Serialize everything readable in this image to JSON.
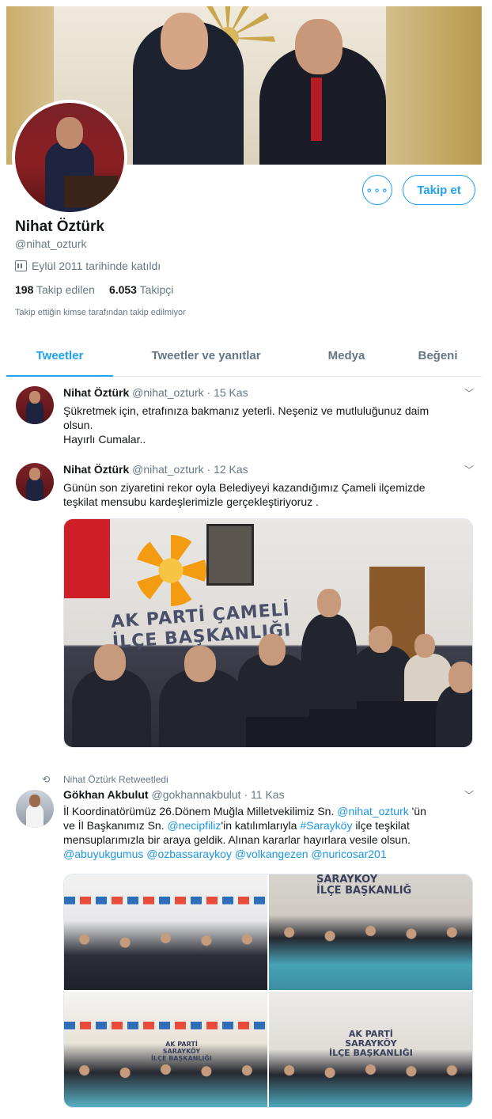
{
  "profile": {
    "name": "Nihat Öztürk",
    "handle": "@nihat_ozturk",
    "joined": "Eylül 2011 tarihinde katıldı",
    "following_count": "198",
    "following_label": "Takip edilen",
    "followers_count": "6.053",
    "followers_label": "Takipçi",
    "notice": "Takip ettiğin kimse tarafından takip edilmiyor",
    "more_label": "∘∘∘",
    "follow_label": "Takip et"
  },
  "tabs": [
    {
      "label": "Tweetler",
      "active": true
    },
    {
      "label": "Tweetler ve yanıtlar",
      "active": false
    },
    {
      "label": "Medya",
      "active": false
    },
    {
      "label": "Beğeni",
      "active": false
    }
  ],
  "tweets": [
    {
      "author": "Nihat Öztürk",
      "handle": "@nihat_ozturk",
      "date": "15 Kas",
      "text_lines": [
        "Şükretmek için, etrafınıza bakmanız yeterli. Neşeniz ve mutluluğunuz daim",
        "olsun.",
        "Hayırlı Cumalar.."
      ]
    },
    {
      "author": "Nihat Öztürk",
      "handle": "@nihat_ozturk",
      "date": "12 Kas",
      "text_lines": [
        "Günün son ziyaretini rekor oyla Belediyeyi kazandığımız Çameli ilçemizde",
        "teşkilat mensubu kardeşlerimizle gerçekleştiriyoruz ."
      ],
      "photo_sign": [
        "AK PARTİ ÇAMELİ",
        "İLÇE BAŞKANLIĞI"
      ]
    },
    {
      "retweet_label": "Nihat Öztürk Retweetledi",
      "author": "Gökhan Akbulut",
      "handle": "@gokhannakbulut",
      "date": "11 Kas",
      "seg1": "İl Koordinatörümüz  26.Dönem Muğla Milletvekilimiz Sn. ",
      "mention1": "@nihat_ozturk",
      "seg2": " 'ün",
      "seg3": "ve İl Başkanımız Sn. ",
      "mention2": "@necipfiliz",
      "seg4": "'in katılımlarıyla ",
      "hashtag": "#Sarayköy",
      "seg5": " ilçe teşkilat",
      "line3": "mensuplarımızla  bir araya geldik. Alınan kararlar hayırlara vesile olsun.",
      "mentions_line": "@abuyukgumus @ozbassaraykoy @volkangezen @nuricosar201",
      "photo_sign_1": "SARAYKÖY",
      "photo_sign_2": "İLÇE BAŞKANLIĞ",
      "photo_sign_3": [
        "AK PARTİ",
        "SARAYKÖY",
        "İLÇE BAŞKANLIĞI"
      ],
      "photo_sign_4": [
        "AK PARTİ",
        "SARAYKÖY",
        "İLÇE BAŞKANLIĞI"
      ]
    }
  ],
  "colors": {
    "accent": "#1da1f2",
    "text": "#14171a",
    "muted": "#657786",
    "link": "#1b95e0"
  }
}
